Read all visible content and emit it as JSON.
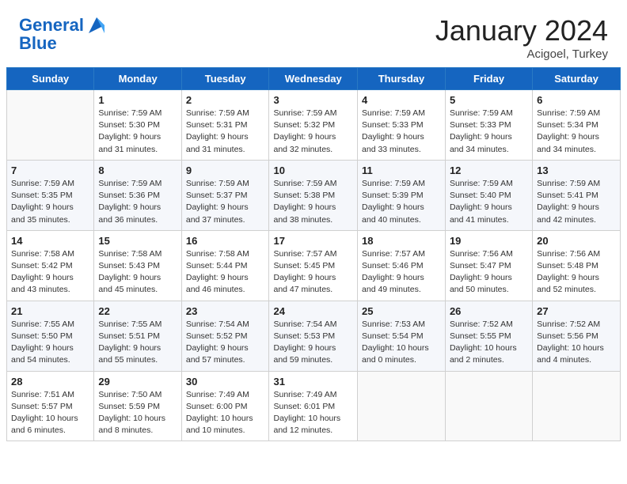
{
  "header": {
    "logo_line1": "General",
    "logo_line2": "Blue",
    "month": "January 2024",
    "location": "Acigoel, Turkey"
  },
  "days_of_week": [
    "Sunday",
    "Monday",
    "Tuesday",
    "Wednesday",
    "Thursday",
    "Friday",
    "Saturday"
  ],
  "weeks": [
    [
      {
        "day": "",
        "info": ""
      },
      {
        "day": "1",
        "info": "Sunrise: 7:59 AM\nSunset: 5:30 PM\nDaylight: 9 hours\nand 31 minutes."
      },
      {
        "day": "2",
        "info": "Sunrise: 7:59 AM\nSunset: 5:31 PM\nDaylight: 9 hours\nand 31 minutes."
      },
      {
        "day": "3",
        "info": "Sunrise: 7:59 AM\nSunset: 5:32 PM\nDaylight: 9 hours\nand 32 minutes."
      },
      {
        "day": "4",
        "info": "Sunrise: 7:59 AM\nSunset: 5:33 PM\nDaylight: 9 hours\nand 33 minutes."
      },
      {
        "day": "5",
        "info": "Sunrise: 7:59 AM\nSunset: 5:33 PM\nDaylight: 9 hours\nand 34 minutes."
      },
      {
        "day": "6",
        "info": "Sunrise: 7:59 AM\nSunset: 5:34 PM\nDaylight: 9 hours\nand 34 minutes."
      }
    ],
    [
      {
        "day": "7",
        "info": "Sunrise: 7:59 AM\nSunset: 5:35 PM\nDaylight: 9 hours\nand 35 minutes."
      },
      {
        "day": "8",
        "info": "Sunrise: 7:59 AM\nSunset: 5:36 PM\nDaylight: 9 hours\nand 36 minutes."
      },
      {
        "day": "9",
        "info": "Sunrise: 7:59 AM\nSunset: 5:37 PM\nDaylight: 9 hours\nand 37 minutes."
      },
      {
        "day": "10",
        "info": "Sunrise: 7:59 AM\nSunset: 5:38 PM\nDaylight: 9 hours\nand 38 minutes."
      },
      {
        "day": "11",
        "info": "Sunrise: 7:59 AM\nSunset: 5:39 PM\nDaylight: 9 hours\nand 40 minutes."
      },
      {
        "day": "12",
        "info": "Sunrise: 7:59 AM\nSunset: 5:40 PM\nDaylight: 9 hours\nand 41 minutes."
      },
      {
        "day": "13",
        "info": "Sunrise: 7:59 AM\nSunset: 5:41 PM\nDaylight: 9 hours\nand 42 minutes."
      }
    ],
    [
      {
        "day": "14",
        "info": "Sunrise: 7:58 AM\nSunset: 5:42 PM\nDaylight: 9 hours\nand 43 minutes."
      },
      {
        "day": "15",
        "info": "Sunrise: 7:58 AM\nSunset: 5:43 PM\nDaylight: 9 hours\nand 45 minutes."
      },
      {
        "day": "16",
        "info": "Sunrise: 7:58 AM\nSunset: 5:44 PM\nDaylight: 9 hours\nand 46 minutes."
      },
      {
        "day": "17",
        "info": "Sunrise: 7:57 AM\nSunset: 5:45 PM\nDaylight: 9 hours\nand 47 minutes."
      },
      {
        "day": "18",
        "info": "Sunrise: 7:57 AM\nSunset: 5:46 PM\nDaylight: 9 hours\nand 49 minutes."
      },
      {
        "day": "19",
        "info": "Sunrise: 7:56 AM\nSunset: 5:47 PM\nDaylight: 9 hours\nand 50 minutes."
      },
      {
        "day": "20",
        "info": "Sunrise: 7:56 AM\nSunset: 5:48 PM\nDaylight: 9 hours\nand 52 minutes."
      }
    ],
    [
      {
        "day": "21",
        "info": "Sunrise: 7:55 AM\nSunset: 5:50 PM\nDaylight: 9 hours\nand 54 minutes."
      },
      {
        "day": "22",
        "info": "Sunrise: 7:55 AM\nSunset: 5:51 PM\nDaylight: 9 hours\nand 55 minutes."
      },
      {
        "day": "23",
        "info": "Sunrise: 7:54 AM\nSunset: 5:52 PM\nDaylight: 9 hours\nand 57 minutes."
      },
      {
        "day": "24",
        "info": "Sunrise: 7:54 AM\nSunset: 5:53 PM\nDaylight: 9 hours\nand 59 minutes."
      },
      {
        "day": "25",
        "info": "Sunrise: 7:53 AM\nSunset: 5:54 PM\nDaylight: 10 hours\nand 0 minutes."
      },
      {
        "day": "26",
        "info": "Sunrise: 7:52 AM\nSunset: 5:55 PM\nDaylight: 10 hours\nand 2 minutes."
      },
      {
        "day": "27",
        "info": "Sunrise: 7:52 AM\nSunset: 5:56 PM\nDaylight: 10 hours\nand 4 minutes."
      }
    ],
    [
      {
        "day": "28",
        "info": "Sunrise: 7:51 AM\nSunset: 5:57 PM\nDaylight: 10 hours\nand 6 minutes."
      },
      {
        "day": "29",
        "info": "Sunrise: 7:50 AM\nSunset: 5:59 PM\nDaylight: 10 hours\nand 8 minutes."
      },
      {
        "day": "30",
        "info": "Sunrise: 7:49 AM\nSunset: 6:00 PM\nDaylight: 10 hours\nand 10 minutes."
      },
      {
        "day": "31",
        "info": "Sunrise: 7:49 AM\nSunset: 6:01 PM\nDaylight: 10 hours\nand 12 minutes."
      },
      {
        "day": "",
        "info": ""
      },
      {
        "day": "",
        "info": ""
      },
      {
        "day": "",
        "info": ""
      }
    ]
  ]
}
